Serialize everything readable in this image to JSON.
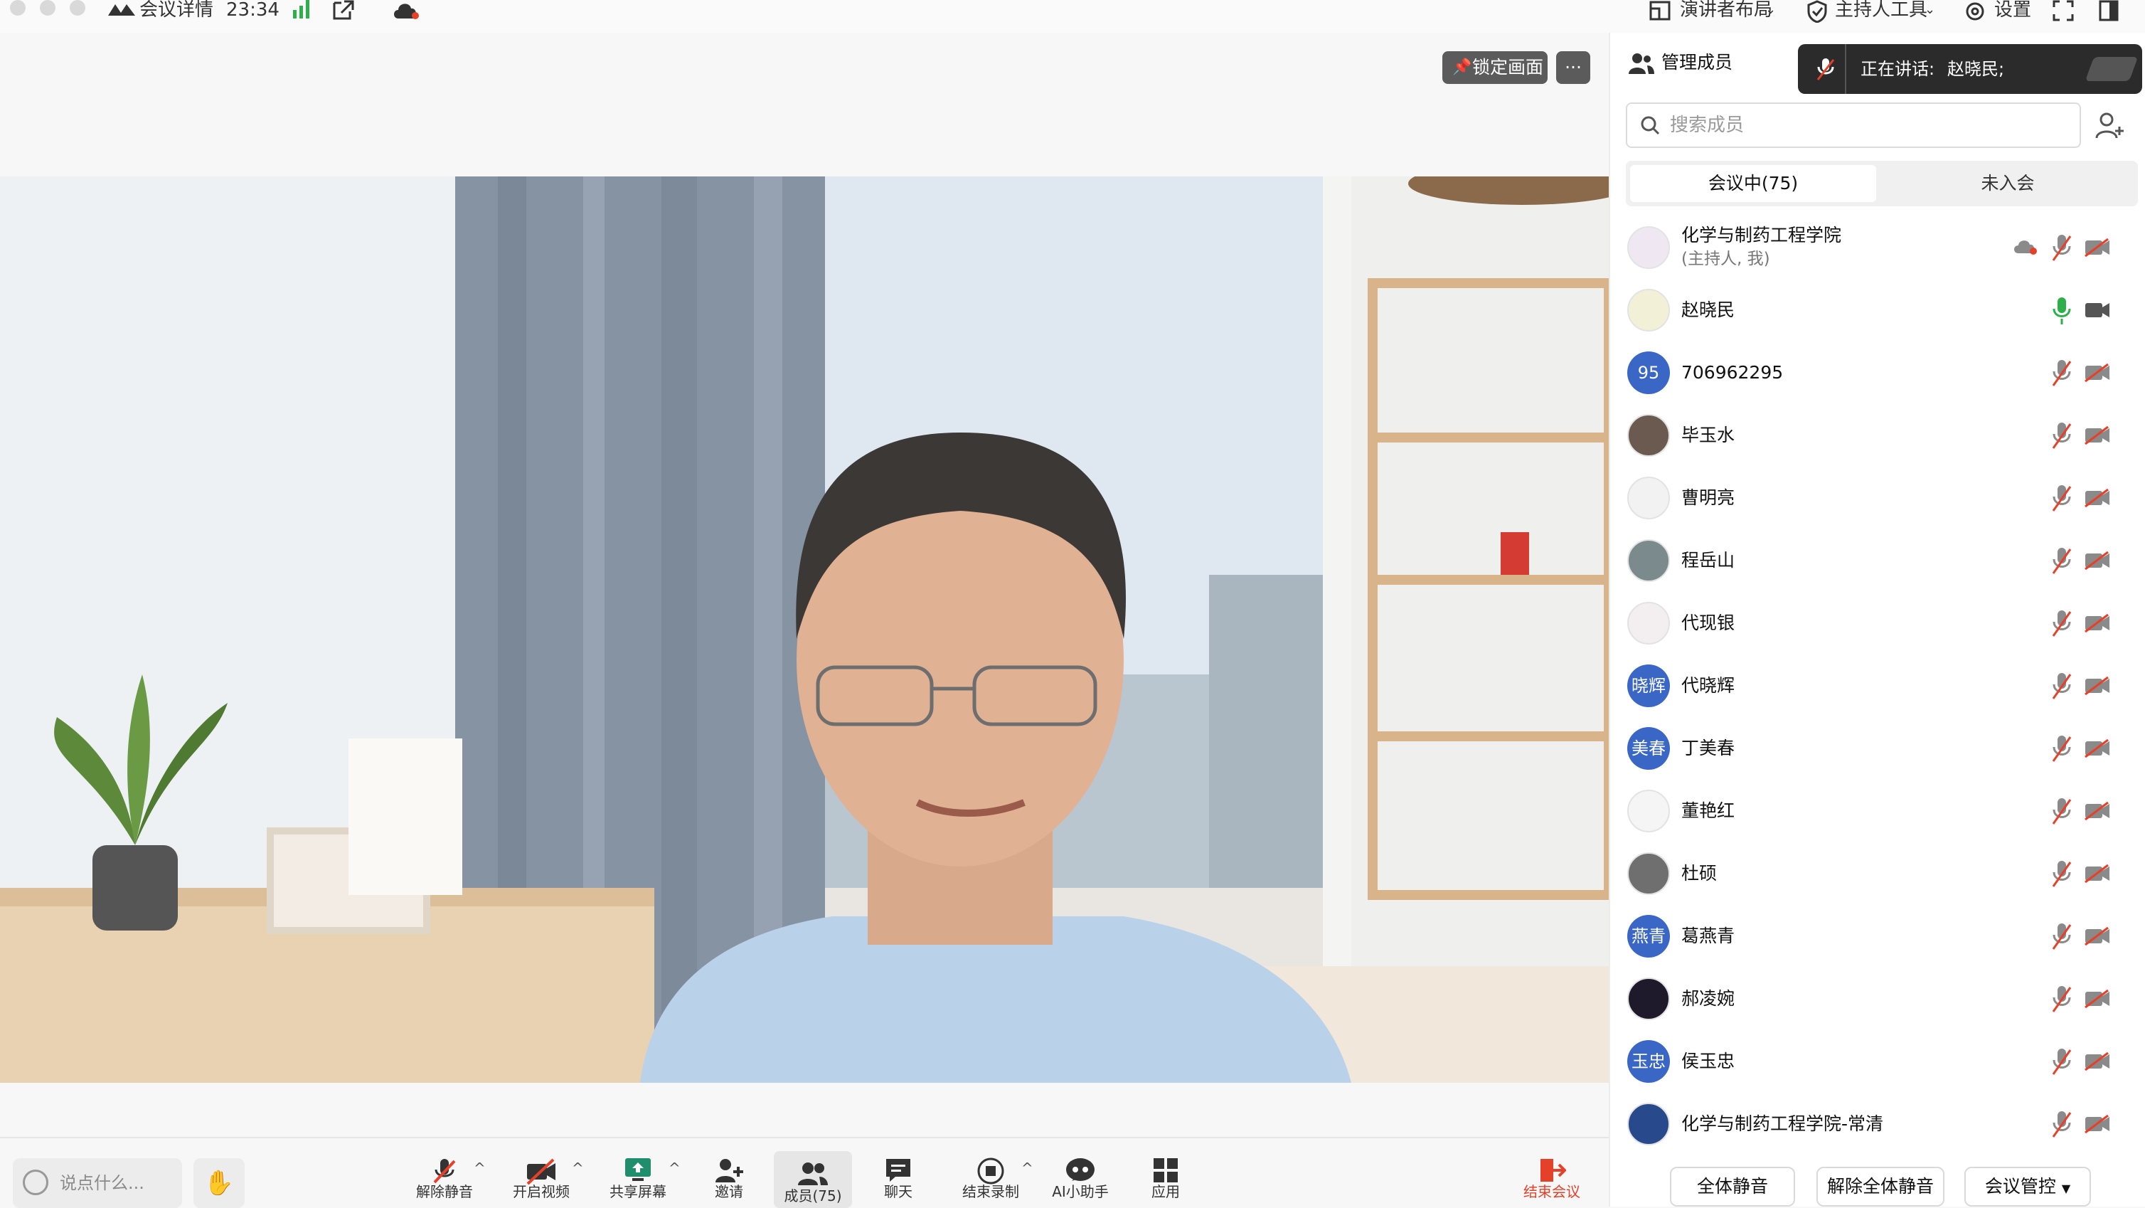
{
  "topbar": {
    "meeting_details": "会议详情",
    "time": "23:34",
    "layout_label": "演讲者布局",
    "host_tools_label": "主持人工具",
    "settings_label": "设置"
  },
  "stage": {
    "lock_button": "锁定画面",
    "more_button": "···"
  },
  "toolbar": {
    "chat_placeholder": "说点什么...",
    "buttons": [
      {
        "label": "解除静音"
      },
      {
        "label": "开启视频"
      },
      {
        "label": "共享屏幕"
      },
      {
        "label": "邀请"
      },
      {
        "label": "成员(75)"
      },
      {
        "label": "聊天"
      },
      {
        "label": "结束录制"
      },
      {
        "label": "AI小助手"
      },
      {
        "label": "应用"
      }
    ],
    "end_meeting": "结束会议"
  },
  "speaking": {
    "label": "正在讲话:",
    "name": "赵晓民;"
  },
  "panel": {
    "title": "管理成员",
    "search_placeholder": "搜索成员",
    "tabs": [
      "会议中(75)",
      "未入会"
    ],
    "members": [
      {
        "name": "化学与制药工程学院",
        "sub": "(主持人, 我)",
        "avatar_text": "",
        "avatar_color": "#efe8f2",
        "mic": "off",
        "cam": "off",
        "cloud": true
      },
      {
        "name": "赵晓民",
        "avatar_text": "",
        "avatar_color": "#f3f0d8",
        "mic": "on",
        "cam": "on"
      },
      {
        "name": "706962295",
        "avatar_text": "95",
        "avatar_color": "#3a66c6",
        "mic": "off",
        "cam": "off"
      },
      {
        "name": "毕玉水",
        "avatar_text": "",
        "avatar_color": "#6b5a50",
        "mic": "off",
        "cam": "off"
      },
      {
        "name": "曹明亮",
        "avatar_text": "",
        "avatar_color": "#f2f2f2",
        "mic": "off",
        "cam": "off"
      },
      {
        "name": "程岳山",
        "avatar_text": "",
        "avatar_color": "#7b8a8c",
        "mic": "off",
        "cam": "off"
      },
      {
        "name": "代现银",
        "avatar_text": "",
        "avatar_color": "#f3eef0",
        "mic": "off",
        "cam": "off"
      },
      {
        "name": "代晓辉",
        "avatar_text": "晓辉",
        "avatar_color": "#3a66c6",
        "mic": "off",
        "cam": "off"
      },
      {
        "name": "丁美春",
        "avatar_text": "美春",
        "avatar_color": "#3a66c6",
        "mic": "off",
        "cam": "off"
      },
      {
        "name": "董艳红",
        "avatar_text": "",
        "avatar_color": "#f5f5f5",
        "mic": "off",
        "cam": "off"
      },
      {
        "name": "杜硕",
        "avatar_text": "",
        "avatar_color": "#6f6f6f",
        "mic": "off",
        "cam": "off"
      },
      {
        "name": "葛燕青",
        "avatar_text": "燕青",
        "avatar_color": "#3a66c6",
        "mic": "off",
        "cam": "off"
      },
      {
        "name": "郝凌婉",
        "avatar_text": "",
        "avatar_color": "#1e1a2c",
        "mic": "off",
        "cam": "off"
      },
      {
        "name": "侯玉忠",
        "avatar_text": "玉忠",
        "avatar_color": "#3a66c6",
        "mic": "off",
        "cam": "off"
      },
      {
        "name": "化学与制药工程学院-常清",
        "avatar_text": "",
        "avatar_color": "#284a8c",
        "mic": "off",
        "cam": "off"
      }
    ],
    "footer": {
      "mute_all": "全体静音",
      "unmute_all": "解除全体静音",
      "meeting_control": "会议管控"
    }
  },
  "colors": {
    "accent_blue": "#3a66c6",
    "mic_on_green": "#2db04a",
    "end_red": "#e5412a"
  }
}
